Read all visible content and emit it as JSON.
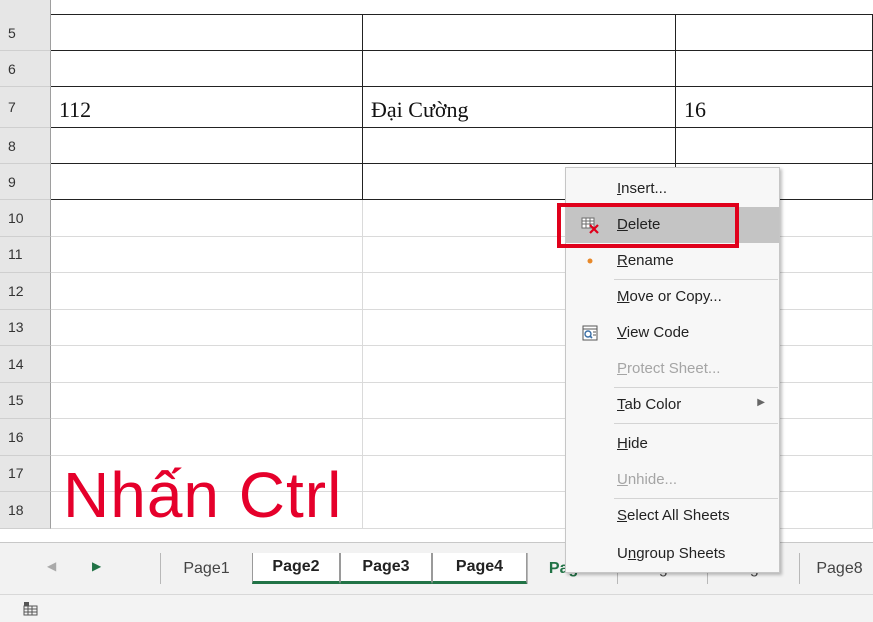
{
  "rows": [
    {
      "num": "5",
      "cells": [
        "",
        "",
        ""
      ]
    },
    {
      "num": "6",
      "cells": [
        "",
        "",
        ""
      ]
    },
    {
      "num": "7",
      "cells": [
        "112",
        "Đại Cường",
        "16"
      ]
    },
    {
      "num": "8",
      "cells": [
        "",
        "",
        ""
      ]
    },
    {
      "num": "9",
      "cells": [
        "",
        "",
        ""
      ]
    },
    {
      "num": "10",
      "cells": [
        "",
        "",
        ""
      ]
    },
    {
      "num": "11",
      "cells": [
        "",
        "",
        ""
      ]
    },
    {
      "num": "12",
      "cells": [
        "",
        "",
        ""
      ]
    },
    {
      "num": "13",
      "cells": [
        "",
        "",
        ""
      ]
    },
    {
      "num": "14",
      "cells": [
        "",
        "",
        ""
      ]
    },
    {
      "num": "15",
      "cells": [
        "",
        "",
        ""
      ]
    },
    {
      "num": "16",
      "cells": [
        "",
        "",
        ""
      ]
    },
    {
      "num": "17",
      "cells": [
        "",
        "",
        ""
      ]
    },
    {
      "num": "18",
      "cells": [
        "",
        "",
        ""
      ]
    }
  ],
  "overlay_text": "Nhấn Ctrl",
  "sheet_tabs": [
    "Page1",
    "Page2",
    "Page3",
    "Page4",
    "Page5",
    "Page6",
    "Page7",
    "Page8"
  ],
  "context_menu": {
    "items": [
      {
        "label": "Insert...",
        "accel": "I",
        "disabled": false
      },
      {
        "label": "Delete",
        "accel": "D",
        "disabled": false,
        "icon": "delete-sheet-icon"
      },
      {
        "label": "Rename",
        "accel": "R",
        "disabled": false,
        "icon": "dot-icon"
      },
      {
        "label": "Move or Copy...",
        "accel": "M",
        "disabled": false
      },
      {
        "label": "View Code",
        "accel": "V",
        "disabled": false,
        "icon": "view-code-icon"
      },
      {
        "label": "Protect Sheet...",
        "accel": "P",
        "disabled": true
      },
      {
        "label": "Tab Color",
        "accel": "T",
        "disabled": false,
        "submenu": true
      },
      {
        "label": "Hide",
        "accel": "H",
        "disabled": false
      },
      {
        "label": "Unhide...",
        "accel": "U",
        "disabled": true
      },
      {
        "label": "Select All Sheets",
        "accel": "S",
        "disabled": false
      },
      {
        "label": "Ungroup Sheets",
        "accel": "n",
        "disabled": false
      }
    ]
  },
  "colors": {
    "accent_green": "#217346",
    "highlight_red": "#e0001b",
    "overlay_text_red": "#e5002b"
  }
}
